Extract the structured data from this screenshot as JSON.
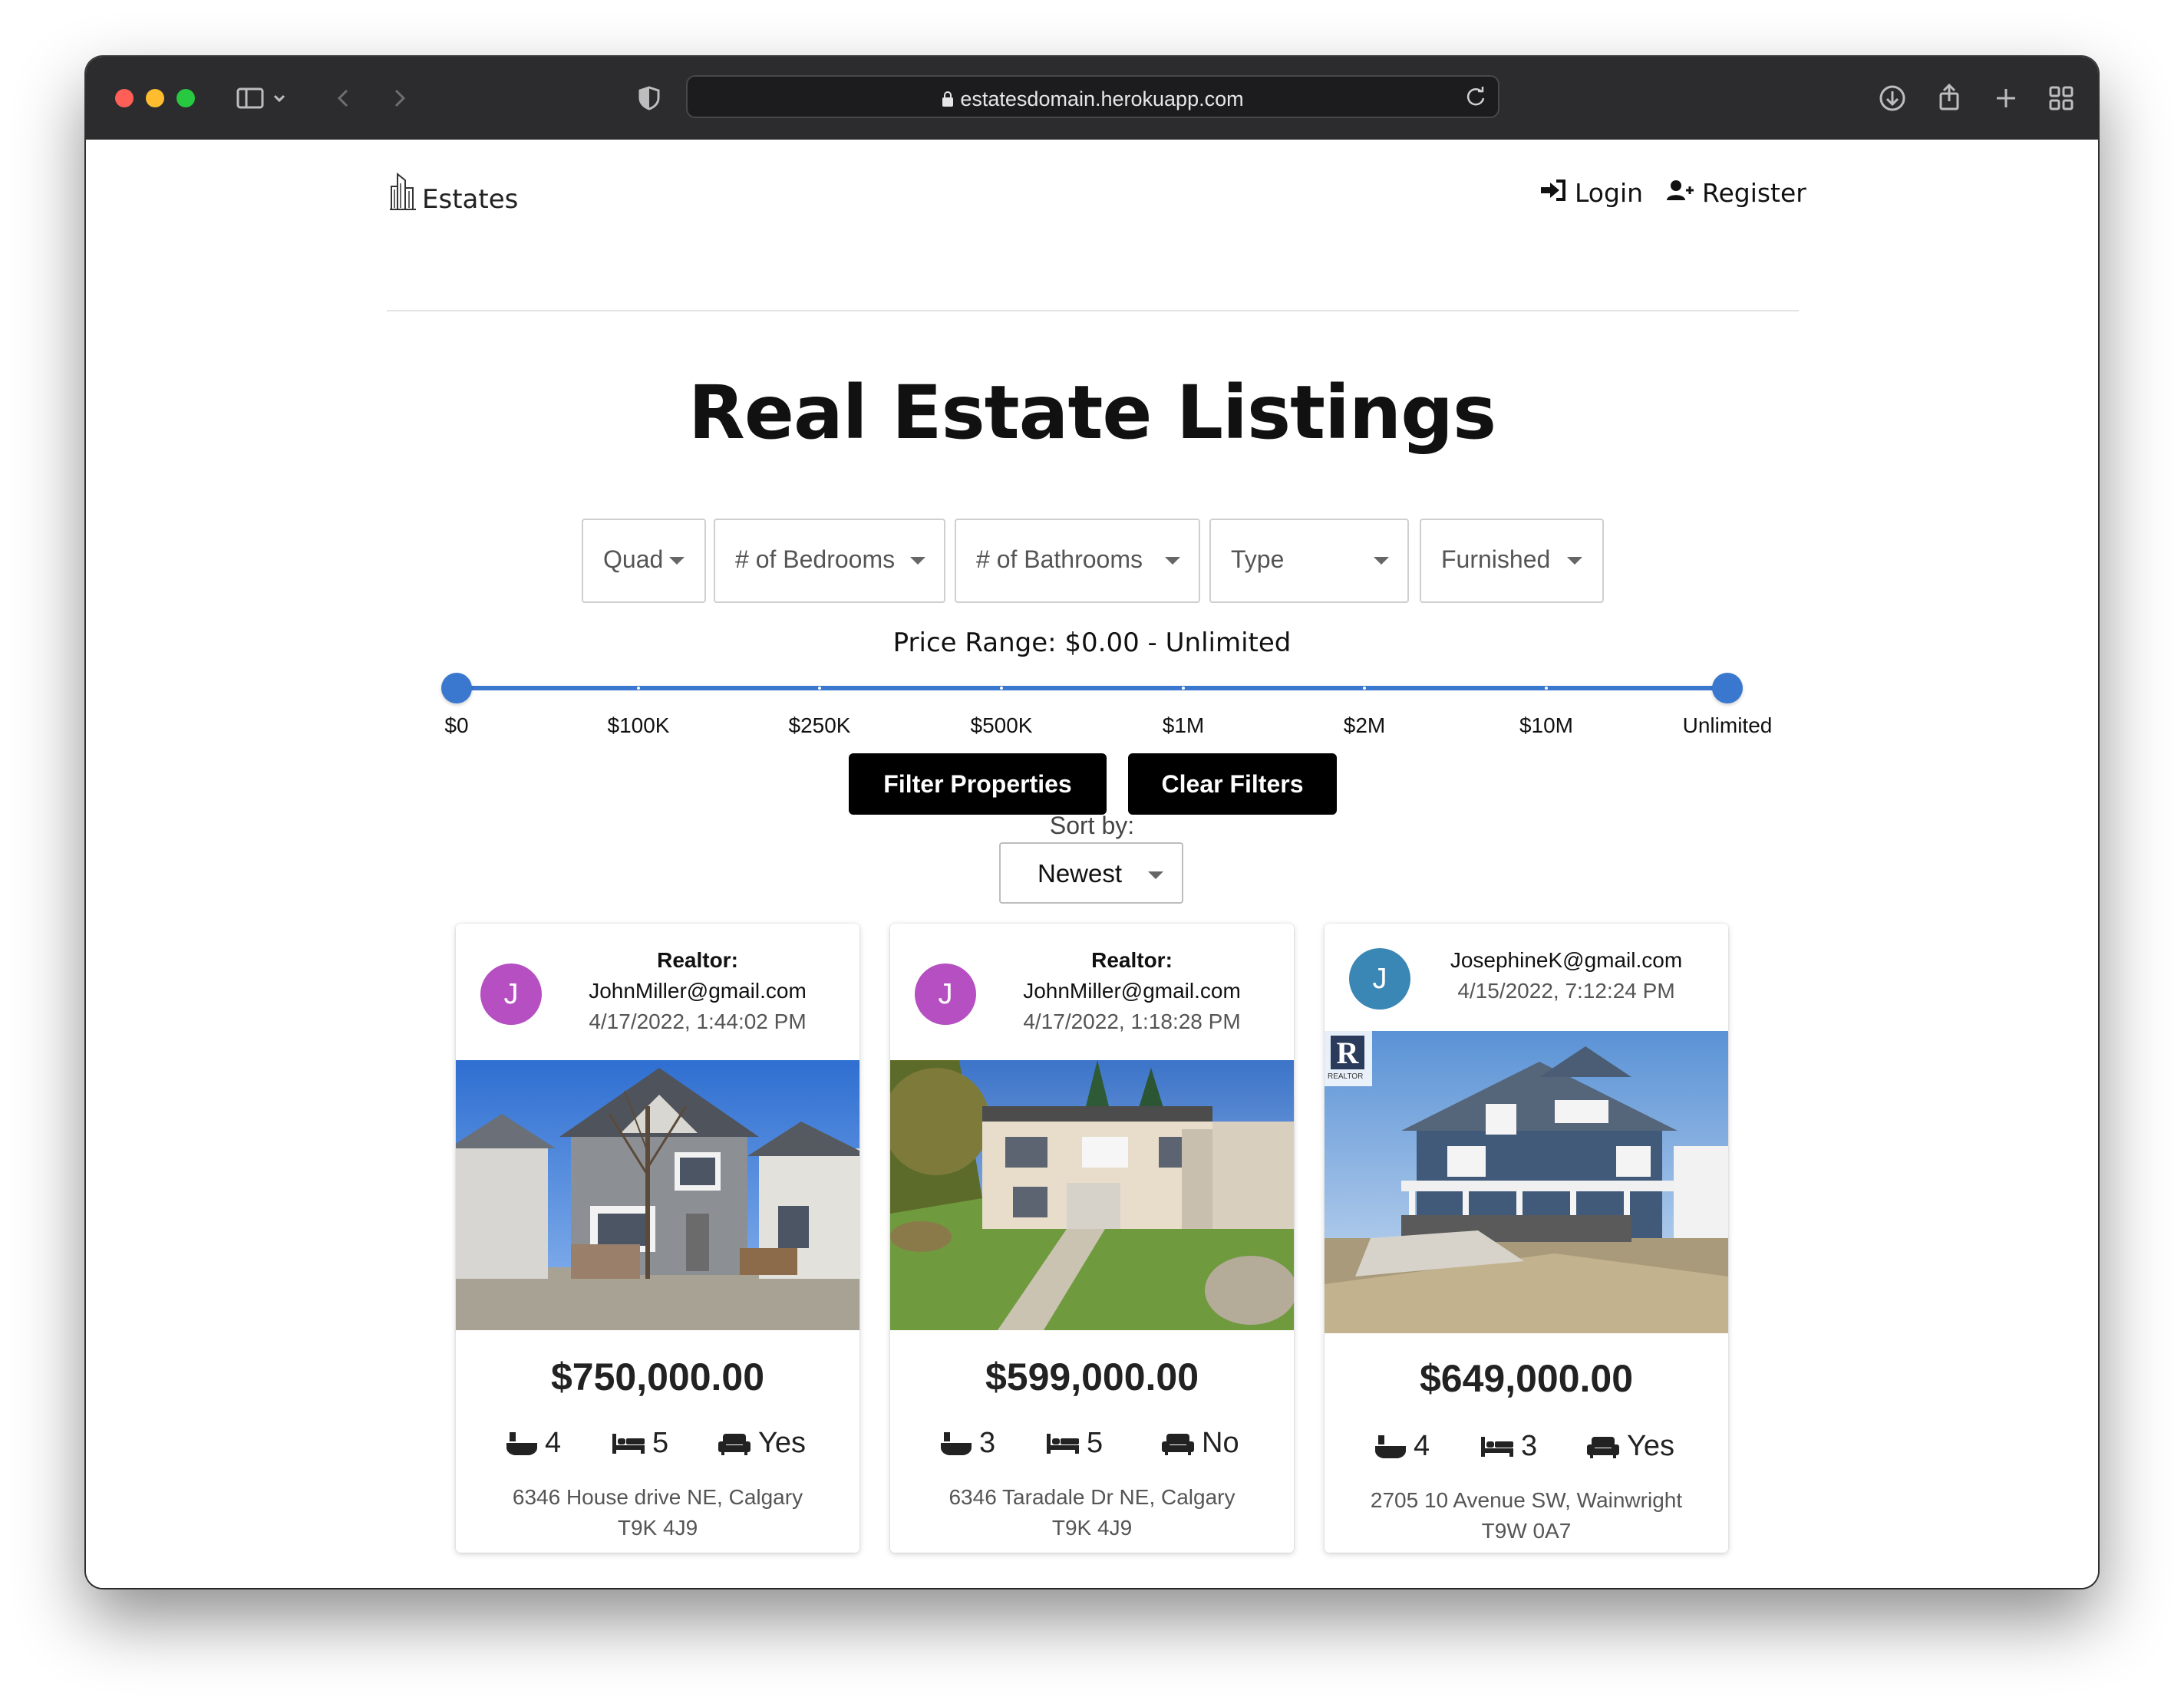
{
  "browser": {
    "url": "estatesdomain.herokuapp.com"
  },
  "nav": {
    "brand": "Estates",
    "login": "Login",
    "register": "Register"
  },
  "page": {
    "title": "Real Estate Listings"
  },
  "filters": {
    "quad": "Quad",
    "bedrooms": "# of Bedrooms",
    "bathrooms": "# of Bathrooms",
    "type": "Type",
    "furnished": "Furnished"
  },
  "price_range": {
    "label": "Price Range: $0.00 - Unlimited",
    "ticks": [
      "$0",
      "$100K",
      "$250K",
      "$500K",
      "$1M",
      "$2M",
      "$10M",
      "Unlimited"
    ],
    "selected_min": "$0",
    "selected_max": "Unlimited"
  },
  "buttons": {
    "filter": "Filter Properties",
    "clear": "Clear Filters"
  },
  "sort": {
    "label": "Sort by:",
    "value": "Newest"
  },
  "listings": [
    {
      "avatar_letter": "J",
      "avatar_color": "#b54fc2",
      "realtor_label": "Realtor:",
      "email": "JohnMiller@gmail.com",
      "date": "4/17/2022, 1:44:02 PM",
      "price": "$750,000.00",
      "bathrooms": "4",
      "bedrooms": "5",
      "furnished": "Yes",
      "address_line1": "6346 House drive NE, Calgary",
      "address_line2": "T9K 4J9"
    },
    {
      "avatar_letter": "J",
      "avatar_color": "#b54fc2",
      "realtor_label": "Realtor:",
      "email": "JohnMiller@gmail.com",
      "date": "4/17/2022, 1:18:28 PM",
      "price": "$599,000.00",
      "bathrooms": "3",
      "bedrooms": "5",
      "furnished": "No",
      "address_line1": "6346 Taradale Dr NE, Calgary",
      "address_line2": "T9K 4J9"
    },
    {
      "avatar_letter": "J",
      "avatar_color": "#3a86b5",
      "email": "JosephineK@gmail.com",
      "date": "4/15/2022, 7:12:24 PM",
      "price": "$649,000.00",
      "bathrooms": "4",
      "bedrooms": "3",
      "furnished": "Yes",
      "address_line1": "2705 10 Avenue SW, Wainwright",
      "address_line2": "T9W 0A7",
      "photo_badge": "REALTOR"
    }
  ]
}
